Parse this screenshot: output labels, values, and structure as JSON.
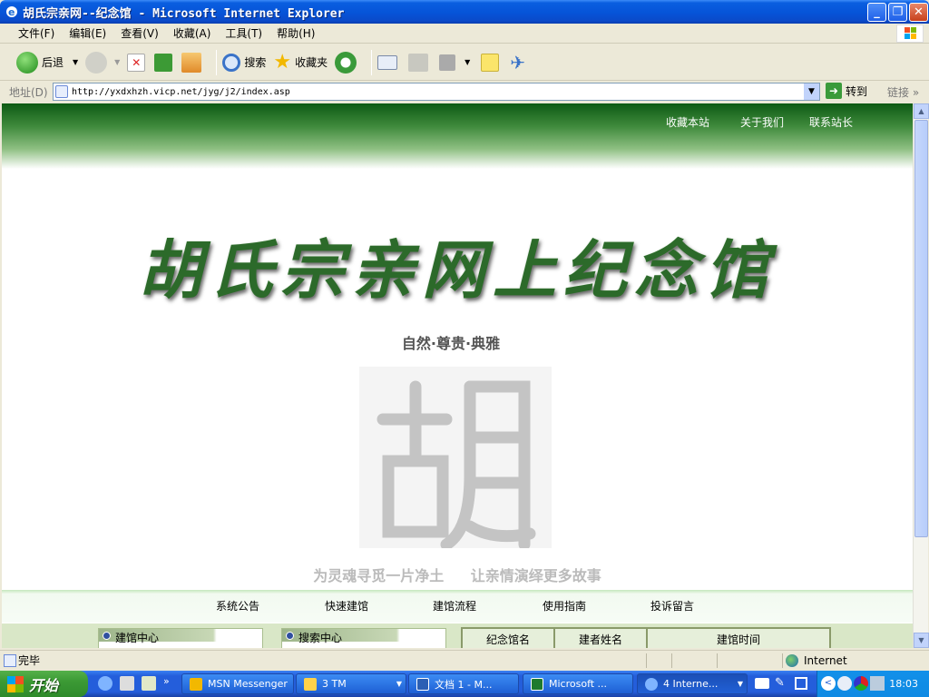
{
  "window": {
    "title": "胡氏宗亲网--纪念馆 - Microsoft Internet Explorer"
  },
  "menu": [
    "文件(F)",
    "编辑(E)",
    "查看(V)",
    "收藏(A)",
    "工具(T)",
    "帮助(H)"
  ],
  "toolbar": {
    "back": "后退",
    "search": "搜索",
    "favorites": "收藏夹"
  },
  "address": {
    "label": "地址(D)",
    "url": "http://yxdxhzh.vicp.net/jyg/j2/index.asp",
    "go": "转到",
    "links": "链接"
  },
  "page": {
    "top_links": [
      "收藏本站",
      "关于我们",
      "联系站长"
    ],
    "title": "胡氏宗亲网上纪念馆",
    "subtitle": "自然·尊贵·典雅",
    "watermark": "胡",
    "slogan": [
      "为灵魂寻觅一片净土",
      "让亲情演绎更多故事"
    ],
    "nav": [
      "系统公告",
      "快速建馆",
      "建馆流程",
      "使用指南",
      "投诉留言"
    ],
    "panels": [
      "建馆中心",
      "搜索中心"
    ],
    "table_headers": [
      "纪念馆名",
      "建者姓名",
      "建馆时间"
    ]
  },
  "status": {
    "text": "完毕",
    "zone": "Internet"
  },
  "taskbar": {
    "start": "开始",
    "buttons": [
      "MSN Messenger",
      "3 TM",
      "文档 1 - M...",
      "Microsoft ...",
      "4 Interne..."
    ],
    "clock": "18:03"
  },
  "colors": {
    "xp_blue": "#0654d8",
    "banner_green": "#2c6a2a",
    "start_green": "#3c9a35"
  }
}
